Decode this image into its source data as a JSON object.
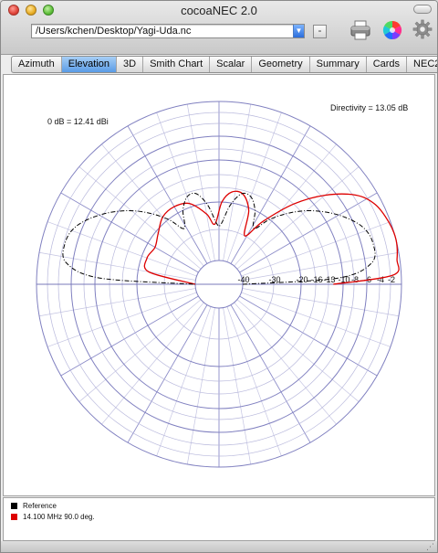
{
  "window": {
    "title": "cocoaNEC 2.0"
  },
  "toolbar": {
    "file_path": "/Users/kchen/Desktop/Yagi-Uda.nc",
    "minus_label": "-",
    "print_icon": "printer-icon",
    "color_icon": "color-wheel-icon",
    "settings_icon": "gear-icon"
  },
  "tabs": [
    "Azimuth",
    "Elevation",
    "3D",
    "Smith Chart",
    "Scalar",
    "Geometry",
    "Summary",
    "Cards",
    "NEC2 Output"
  ],
  "active_tab": "Elevation",
  "plot": {
    "reference_label": "0 dB = 12.41 dBi",
    "directivity_label": "Directivity = 13.05 dB",
    "ring_labels": [
      "-40",
      "-30",
      "-20",
      "-16",
      "-13",
      "-10",
      "-8",
      "-6",
      "-4",
      "-2"
    ]
  },
  "chart_data": {
    "type": "polar",
    "title": "",
    "reference_dbi": 12.41,
    "directivity_db": 13.05,
    "rings_db": [
      -40,
      -30,
      -20,
      -16,
      -13,
      -10,
      -8,
      -6,
      -4,
      -2,
      0
    ],
    "angle_step_deg": 10,
    "series": [
      {
        "name": "14.100 MHz 90.0 deg.",
        "color": "#dd0000",
        "style": "solid",
        "points": [
          {
            "angle": 0,
            "db": -12
          },
          {
            "angle": 3,
            "db": -1.5
          },
          {
            "angle": 8,
            "db": -0.5
          },
          {
            "angle": 14,
            "db": 0
          },
          {
            "angle": 20,
            "db": -0.3
          },
          {
            "angle": 27,
            "db": -1.3
          },
          {
            "angle": 33,
            "db": -3.5
          },
          {
            "angle": 40,
            "db": -7.5
          },
          {
            "angle": 47,
            "db": -13
          },
          {
            "angle": 55,
            "db": -22
          },
          {
            "angle": 62,
            "db": -30
          },
          {
            "angle": 68,
            "db": -21
          },
          {
            "angle": 75,
            "db": -17
          },
          {
            "angle": 82,
            "db": -17
          },
          {
            "angle": 88,
            "db": -20
          },
          {
            "angle": 94,
            "db": -28
          },
          {
            "angle": 100,
            "db": -24
          },
          {
            "angle": 110,
            "db": -19
          },
          {
            "angle": 120,
            "db": -18
          },
          {
            "angle": 130,
            "db": -18.5
          },
          {
            "angle": 140,
            "db": -21
          },
          {
            "angle": 150,
            "db": -23
          },
          {
            "angle": 160,
            "db": -22
          },
          {
            "angle": 170,
            "db": -24
          },
          {
            "angle": 180,
            "db": -40
          }
        ]
      },
      {
        "name": "Reference",
        "color": "#000000",
        "style": "dash-dot",
        "points": [
          {
            "angle": 0,
            "db": -40
          },
          {
            "angle": 3,
            "db": -11
          },
          {
            "angle": 8,
            "db": -5
          },
          {
            "angle": 15,
            "db": -4.2
          },
          {
            "angle": 22,
            "db": -5
          },
          {
            "angle": 30,
            "db": -7.5
          },
          {
            "angle": 38,
            "db": -11
          },
          {
            "angle": 45,
            "db": -15
          },
          {
            "angle": 52,
            "db": -20
          },
          {
            "angle": 58,
            "db": -26
          },
          {
            "angle": 64,
            "db": -20
          },
          {
            "angle": 70,
            "db": -17
          },
          {
            "angle": 76,
            "db": -17
          },
          {
            "angle": 82,
            "db": -21
          },
          {
            "angle": 88,
            "db": -28
          },
          {
            "angle": 92,
            "db": -28
          },
          {
            "angle": 98,
            "db": -21
          },
          {
            "angle": 104,
            "db": -17
          },
          {
            "angle": 110,
            "db": -17
          },
          {
            "angle": 116,
            "db": -20
          },
          {
            "angle": 122,
            "db": -26
          },
          {
            "angle": 128,
            "db": -20
          },
          {
            "angle": 135,
            "db": -15
          },
          {
            "angle": 142,
            "db": -11
          },
          {
            "angle": 150,
            "db": -7.5
          },
          {
            "angle": 158,
            "db": -5
          },
          {
            "angle": 165,
            "db": -4.2
          },
          {
            "angle": 172,
            "db": -5
          },
          {
            "angle": 177,
            "db": -11
          },
          {
            "angle": 180,
            "db": -40
          }
        ]
      }
    ]
  },
  "legend": [
    {
      "label": "Reference",
      "color": "#000000"
    },
    {
      "label": "14.100 MHz 90.0 deg.",
      "color": "#dd0000"
    }
  ]
}
